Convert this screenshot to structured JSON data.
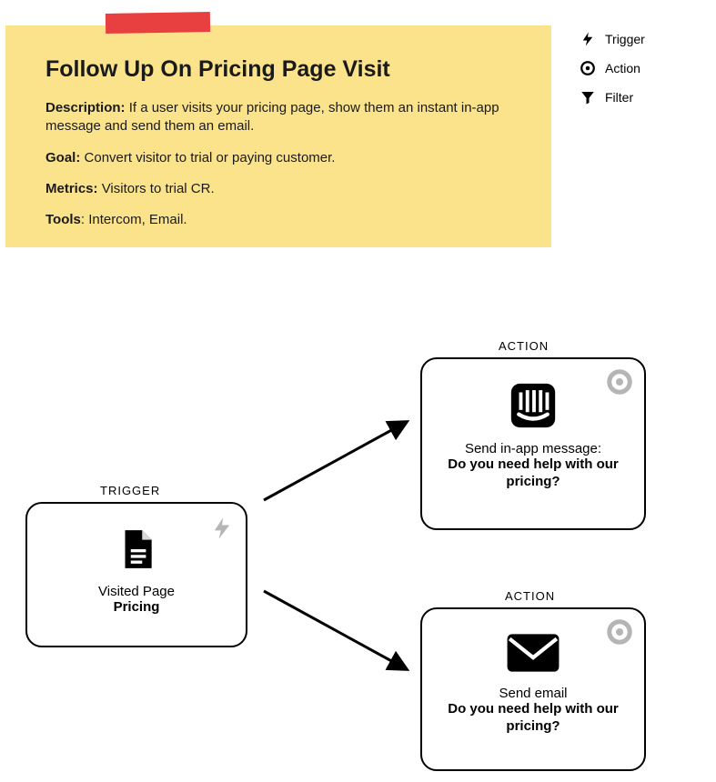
{
  "sticky": {
    "title": "Follow Up On Pricing Page Visit",
    "description_label": "Description:",
    "description_text": "If a user visits your pricing page, show them an instant in-app message and send them an email.",
    "goal_label": "Goal:",
    "goal_text": "Convert visitor to trial or paying customer.",
    "metrics_label": "Metrics:",
    "metrics_text": "Visitors to trial CR.",
    "tools_label": "Tools",
    "tools_text": ": Intercom, Email."
  },
  "legend": {
    "trigger": "Trigger",
    "action": "Action",
    "filter": "Filter"
  },
  "nodes": {
    "trigger": {
      "label": "TRIGGER",
      "line1": "Visited Page",
      "line2": "Pricing"
    },
    "action1": {
      "label": "ACTION",
      "line1": "Send in-app message:",
      "line2": "Do you need help with our pricing?"
    },
    "action2": {
      "label": "ACTION",
      "line1": "Send email",
      "line2": "Do you need help with our pricing?"
    }
  }
}
